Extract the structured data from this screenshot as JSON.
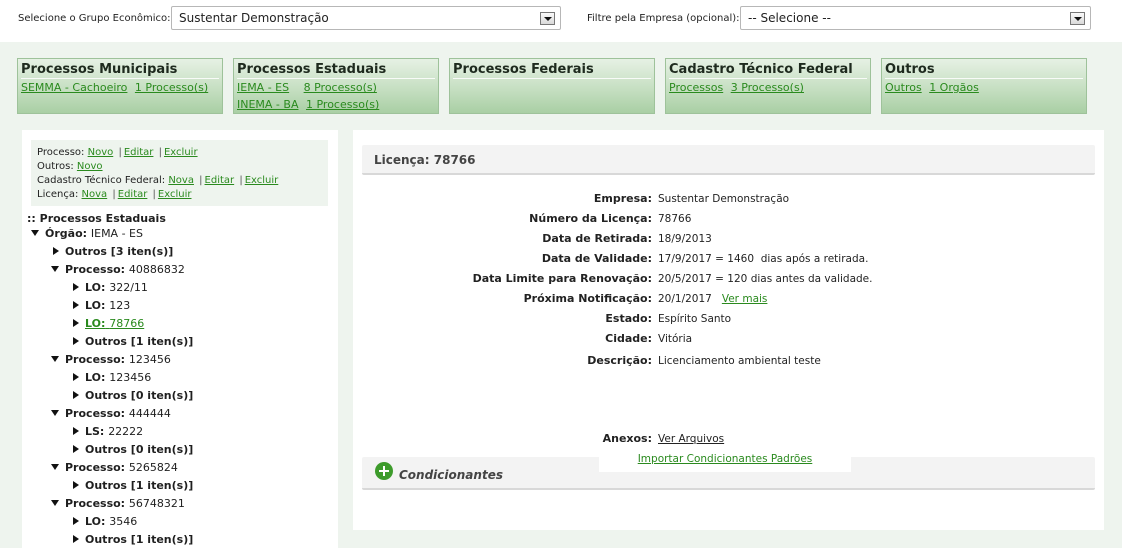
{
  "filters": {
    "group_label": "Selecione o Grupo Econômico:",
    "group_value": "Sustentar Demonstração",
    "company_label": "Filtre pela Empresa (opcional):",
    "company_value": "-- Selecione --"
  },
  "tabs": {
    "municipais": {
      "title": "Processos Municipais",
      "rows": [
        [
          "SEMMA - Cachoeiro",
          "1 Processo(s)"
        ]
      ]
    },
    "estaduais": {
      "title": "Processos Estaduais",
      "rows": [
        [
          "IEMA - ES",
          "8 Processo(s)"
        ],
        [
          "INEMA - BA",
          "1 Processo(s)"
        ]
      ]
    },
    "federais": {
      "title": "Processos Federais"
    },
    "cadastro": {
      "title": "Cadastro Técnico Federal",
      "rows": [
        [
          "Processos",
          "3 Processo(s)"
        ]
      ]
    },
    "outros": {
      "title": "Outros",
      "rows": [
        [
          "Outros",
          "1 Orgãos"
        ]
      ]
    }
  },
  "actions": {
    "processo_label": "Processo:",
    "outros_label": "Outros:",
    "cadastro_label": "Cadastro Técnico Federal:",
    "licenca_label": "Licença:",
    "novo": "Novo",
    "nova": "Nova",
    "editar": "Editar",
    "excluir": "Excluir",
    "sep": "|"
  },
  "tree": {
    "root": ":: Processos Estaduais",
    "orgao_label": "Órgão:",
    "orgao_value": "IEMA - ES",
    "nodes": [
      {
        "label": "Outros [3 iten(s)]",
        "value": ""
      },
      {
        "label": "Processo:",
        "value": "40886832"
      },
      {
        "label": "LO:",
        "value": "322/11"
      },
      {
        "label": "LO:",
        "value": "123"
      },
      {
        "label": "LO:",
        "value": "78766"
      },
      {
        "label": "Outros [1 iten(s)]",
        "value": ""
      },
      {
        "label": "Processo:",
        "value": "123456"
      },
      {
        "label": "LO:",
        "value": "123456"
      },
      {
        "label": "Outros [0 iten(s)]",
        "value": ""
      },
      {
        "label": "Processo:",
        "value": "444444"
      },
      {
        "label": "LS:",
        "value": "22222"
      },
      {
        "label": "Outros [0 iten(s)]",
        "value": ""
      },
      {
        "label": "Processo:",
        "value": "5265824"
      },
      {
        "label": "Outros [1 iten(s)]",
        "value": ""
      },
      {
        "label": "Processo:",
        "value": "56748321"
      },
      {
        "label": "LO:",
        "value": "3546"
      },
      {
        "label": "Outros [1 iten(s)]",
        "value": ""
      }
    ]
  },
  "license": {
    "header": "Licença: 78766",
    "fields": [
      {
        "label": "Empresa:",
        "value": "Sustentar Demonstração"
      },
      {
        "label": "Número da Licença:",
        "value": "78766"
      },
      {
        "label": "Data de Retirada:",
        "value": "18/9/2013"
      },
      {
        "label": "Data de Validade:",
        "value": "17/9/2017 = 1460  dias após a retirada."
      },
      {
        "label": "Data Limite para Renovação:",
        "value": "20/5/2017 = 120 dias antes da validade."
      },
      {
        "label": "Próxima Notificação:",
        "value": "20/1/2017",
        "link": "Ver mais"
      },
      {
        "label": "Estado:",
        "value": "Espírito Santo"
      },
      {
        "label": "Cidade:",
        "value": "Vitória"
      },
      {
        "label": "Descrição:",
        "value": "Licenciamento ambiental teste"
      }
    ],
    "anexos_label": "Anexos:",
    "anexos_link": "Ver Arquivos",
    "import_link": "Importar Condicionantes Padrões",
    "condicionantes": "Condicionantes"
  }
}
